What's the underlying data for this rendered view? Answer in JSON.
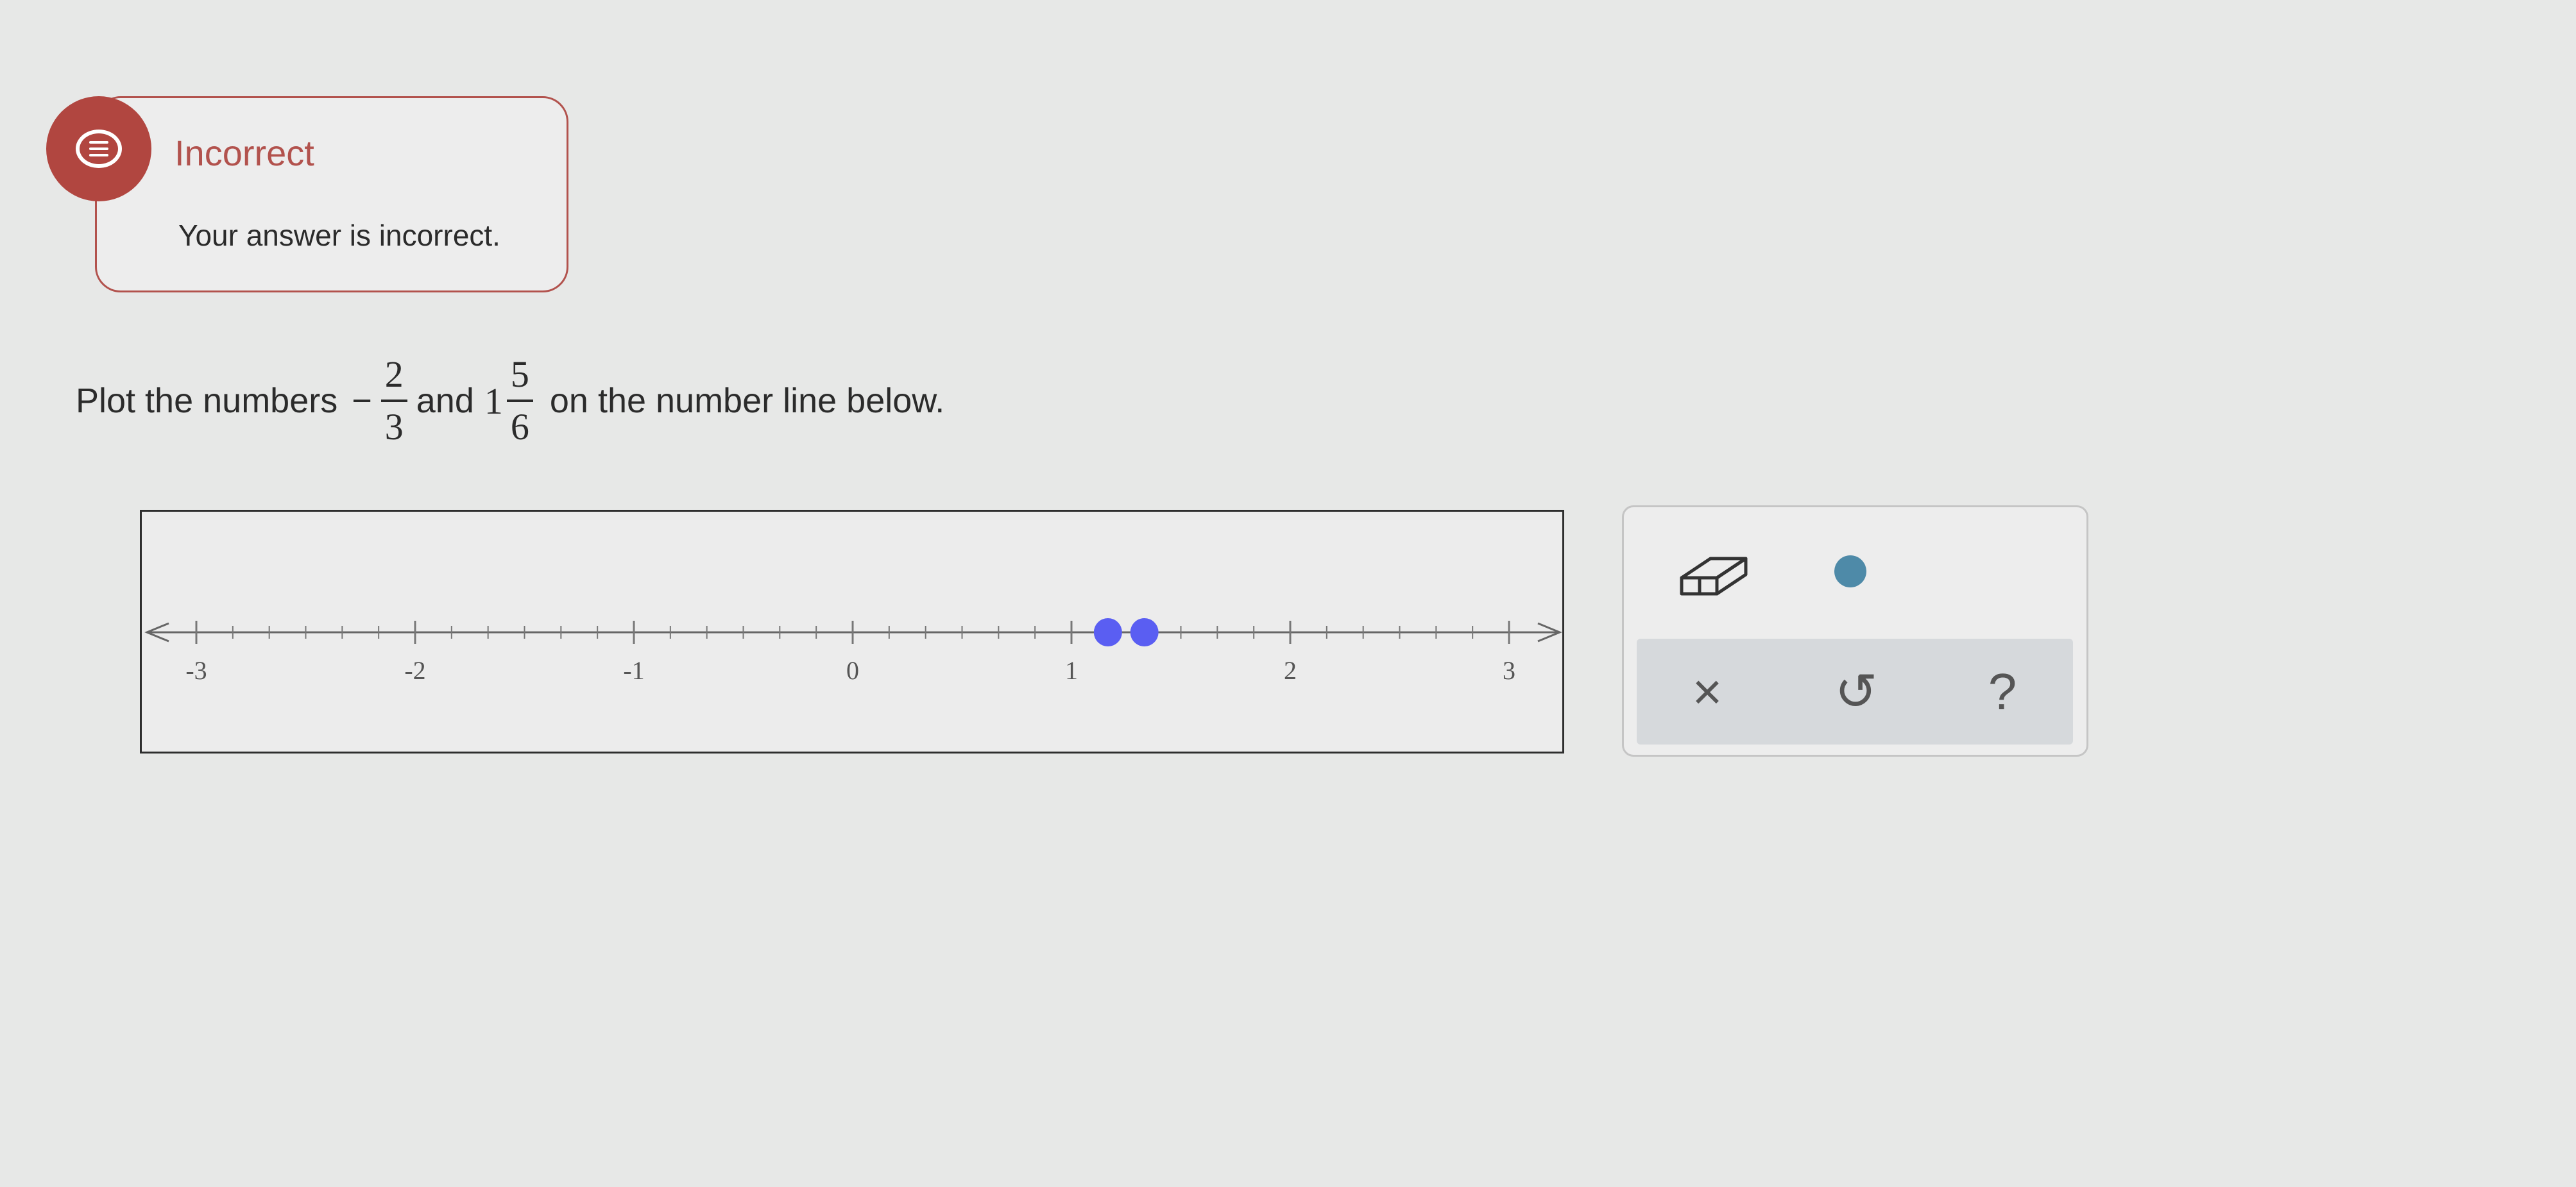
{
  "feedback": {
    "title": "Incorrect",
    "message": "Your answer is incorrect.",
    "icon": "chat-icon",
    "accent_color": "#b2524d"
  },
  "question": {
    "prefix": "Plot the numbers",
    "first_sign": "−",
    "first_numerator": "2",
    "first_denominator": "3",
    "connector": "and",
    "second_whole": "1",
    "second_numerator": "5",
    "second_denominator": "6",
    "suffix": "on the number line below."
  },
  "number_line": {
    "min": -3,
    "max": 3,
    "ticks_per_unit": 6,
    "labels": [
      "-3",
      "-2",
      "-1",
      "0",
      "1",
      "2",
      "3"
    ],
    "plotted_points": [
      1.1667,
      1.3333
    ],
    "point_color": "#5a5ef2"
  },
  "tools": {
    "eraser_icon": "eraser-icon",
    "point_icon": "point-tool-icon",
    "point_color": "#4e8aa8",
    "clear_symbol": "×",
    "undo_symbol": "↺",
    "help_symbol": "?"
  }
}
